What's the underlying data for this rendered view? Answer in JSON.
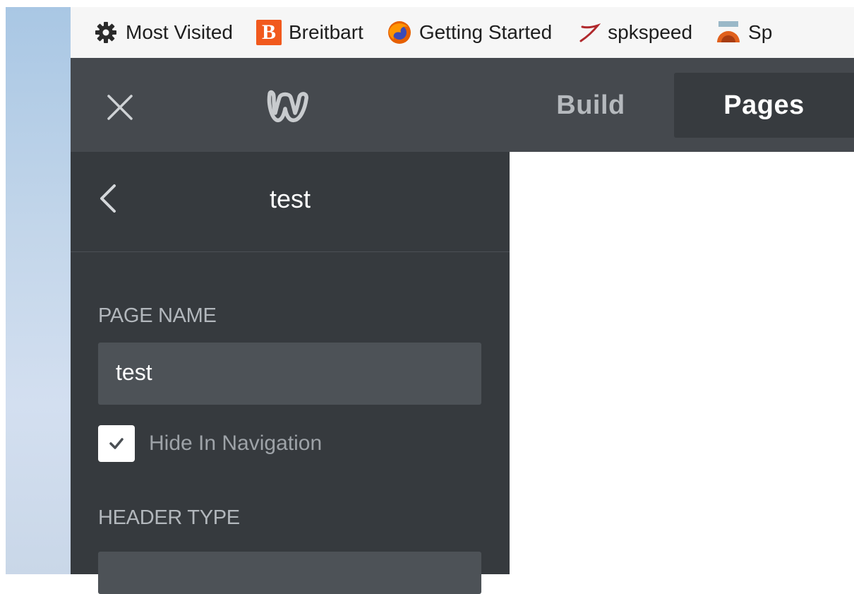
{
  "bookmarks": [
    {
      "label": "Most Visited",
      "icon": "gear-icon"
    },
    {
      "label": "Breitbart",
      "icon": "breitbart-logo-icon",
      "icon_text": "B"
    },
    {
      "label": "Getting Started",
      "icon": "firefox-icon"
    },
    {
      "label": "spkspeed",
      "icon": "spkspeed-icon"
    },
    {
      "label": "Sp",
      "icon": "speedtest-icon"
    }
  ],
  "topbar": {
    "close_icon": "close-icon",
    "logo_icon": "weebly-logo-icon",
    "tabs": [
      {
        "label": "Build",
        "active": false
      },
      {
        "label": "Pages",
        "active": true
      }
    ]
  },
  "panel": {
    "title": "test",
    "back_icon": "chevron-left-icon",
    "page_name_label": "PAGE NAME",
    "page_name_value": "test",
    "hide_in_navigation_label": "Hide In Navigation",
    "hide_in_navigation_checked": true,
    "header_type_label": "HEADER TYPE"
  },
  "colors": {
    "topbar": "#45494e",
    "panel": "#363a3e",
    "input": "#4d5257",
    "breitbart": "#f1591d"
  }
}
